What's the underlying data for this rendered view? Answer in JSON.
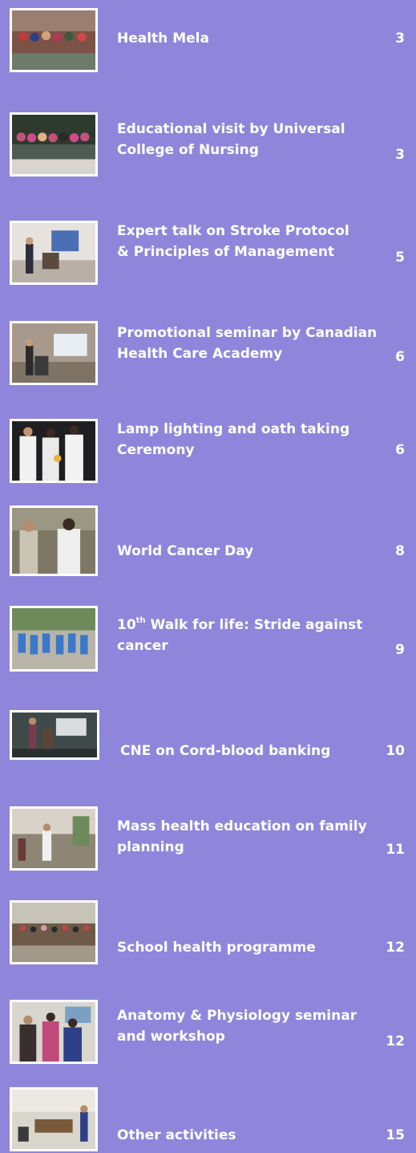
{
  "toc": [
    {
      "title": "Health Mela",
      "page": "3"
    },
    {
      "title_line1": "Educational visit by Universal",
      "title_line2": "College of Nursing",
      "page": "3"
    },
    {
      "title_line1": "Expert talk on Stroke Protocol",
      "title_line2": "& Principles of Management",
      "page": "5"
    },
    {
      "title_line1": "Promotional seminar by Canadian",
      "title_line2": "Health Care Academy",
      "page": "6"
    },
    {
      "title_line1": "Lamp lighting and oath taking",
      "title_line2": "Ceremony",
      "page": "6"
    },
    {
      "title": "World Cancer Day",
      "page": "8"
    },
    {
      "title_prefix": "10",
      "title_sup": "th",
      "title_line1": "Walk for life: Stride against",
      "title_line2": "cancer",
      "page": "9"
    },
    {
      "title": "CNE on Cord-blood banking",
      "page": "10"
    },
    {
      "title_line1": "Mass health education on family",
      "title_line2": "planning",
      "page": "11"
    },
    {
      "title": "School health programme",
      "page": "12"
    },
    {
      "title_line1": "Anatomy & Physiology seminar",
      "title_line2": "and workshop",
      "page": "12"
    },
    {
      "title": "Other activities",
      "page": "15"
    }
  ]
}
